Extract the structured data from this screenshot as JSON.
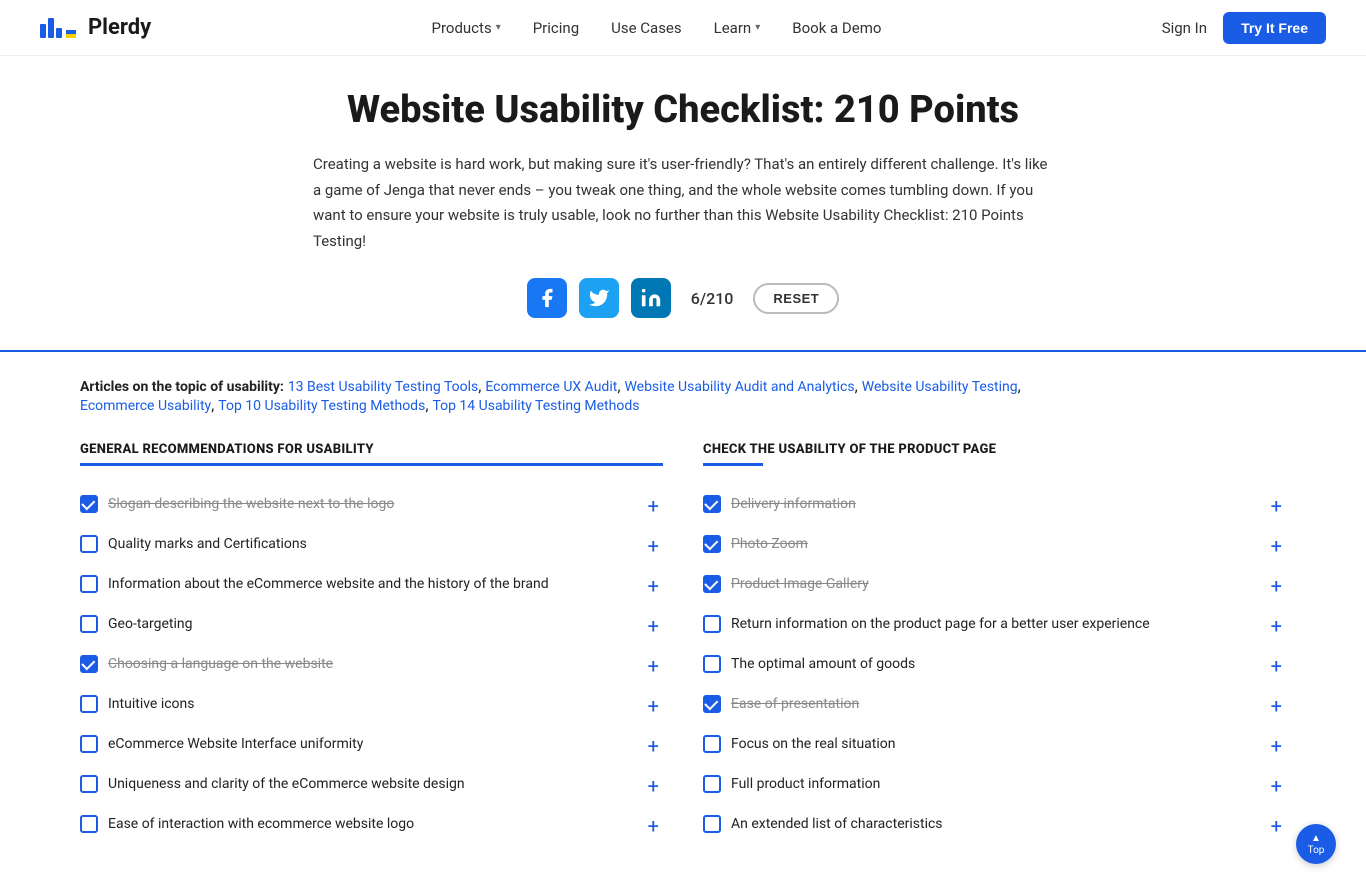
{
  "navbar": {
    "logo_text": "Plerdy",
    "nav_items": [
      {
        "label": "Products",
        "has_chevron": true
      },
      {
        "label": "Pricing",
        "has_chevron": false
      },
      {
        "label": "Use Cases",
        "has_chevron": false
      },
      {
        "label": "Learn",
        "has_chevron": true
      },
      {
        "label": "Book a Demo",
        "has_chevron": false
      }
    ],
    "signin_label": "Sign In",
    "try_free_label": "Try It Free"
  },
  "hero": {
    "title": "Website Usability Checklist: 210 Points",
    "description": "Creating a website is hard work, but making sure it's user-friendly? That's an entirely different challenge. It's like a game of Jenga that never ends – you tweak one thing, and the whole website comes tumbling down. If you want to ensure your website is truly usable, look no further than this Website Usability Checklist: 210 Points Testing!",
    "counter": "6/210",
    "reset_label": "RESET"
  },
  "articles": {
    "label": "Articles on the topic of usability:",
    "links": [
      {
        "text": "13 Best Usability Testing Tools"
      },
      {
        "text": "Ecommerce UX Audit"
      },
      {
        "text": "Website Usability Audit and Analytics"
      },
      {
        "text": "Website Usability Testing"
      },
      {
        "text": "Ecommerce Usability"
      },
      {
        "text": "Top 10 Usability Testing Methods"
      },
      {
        "text": "Top 14 Usability Testing Methods"
      }
    ]
  },
  "col_left": {
    "header": "GENERAL RECOMMENDATIONS FOR USABILITY",
    "items": [
      {
        "label": "Slogan describing the website next to the logo",
        "checked": true,
        "strikethrough": true
      },
      {
        "label": "Quality marks and Certifications",
        "checked": false,
        "strikethrough": false
      },
      {
        "label": "Information about the eCommerce website and the history of the brand",
        "checked": false,
        "strikethrough": false
      },
      {
        "label": "Geo-targeting",
        "checked": false,
        "strikethrough": false
      },
      {
        "label": "Choosing a language on the website",
        "checked": true,
        "strikethrough": true
      },
      {
        "label": "Intuitive icons",
        "checked": false,
        "strikethrough": false
      },
      {
        "label": "eCommerce Website Interface uniformity",
        "checked": false,
        "strikethrough": false
      },
      {
        "label": "Uniqueness and clarity of the eCommerce website design",
        "checked": false,
        "strikethrough": false
      },
      {
        "label": "Ease of interaction with ecommerce website logo",
        "checked": false,
        "strikethrough": false
      }
    ]
  },
  "col_right": {
    "header": "CHECK THE USABILITY OF THE PRODUCT PAGE",
    "items": [
      {
        "label": "Delivery information",
        "checked": true,
        "strikethrough": true
      },
      {
        "label": "Photo Zoom",
        "checked": true,
        "strikethrough": true
      },
      {
        "label": "Product Image Gallery",
        "checked": true,
        "strikethrough": true
      },
      {
        "label": "Return information on the product page for a better user experience",
        "checked": false,
        "strikethrough": false
      },
      {
        "label": "The optimal amount of goods",
        "checked": false,
        "strikethrough": false
      },
      {
        "label": "Ease of presentation",
        "checked": true,
        "strikethrough": true
      },
      {
        "label": "Focus on the real situation",
        "checked": false,
        "strikethrough": false
      },
      {
        "label": "Full product information",
        "checked": false,
        "strikethrough": false
      },
      {
        "label": "An extended list of characteristics",
        "checked": false,
        "strikethrough": false
      }
    ]
  },
  "scroll_top": {
    "label": "Top"
  },
  "colors": {
    "blue": "#1a5ce5",
    "text": "#222",
    "link": "#1a5ce5"
  }
}
